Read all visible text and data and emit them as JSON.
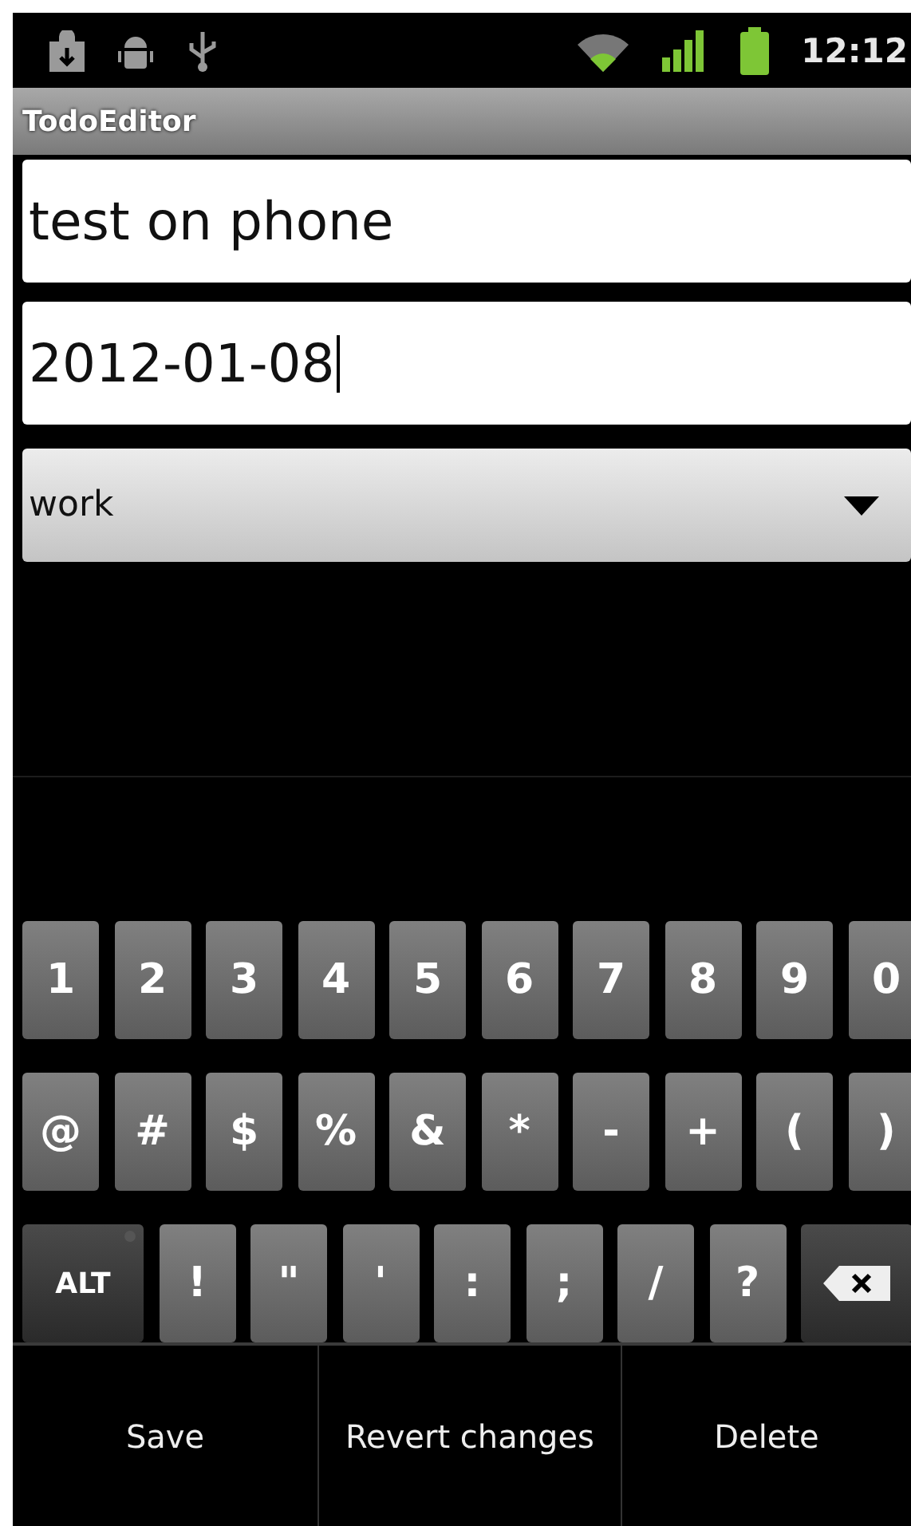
{
  "status_bar": {
    "time": "12:12"
  },
  "title_bar": {
    "title": "TodoEditor"
  },
  "fields": [
    {
      "value": "test on phone",
      "focused": false
    },
    {
      "value": "2012-01-08",
      "focused": true
    }
  ],
  "spinner": {
    "value": "work"
  },
  "keyboard": {
    "rows": [
      [
        {
          "label": "1",
          "kind": "char"
        },
        {
          "label": "2",
          "kind": "char"
        },
        {
          "label": "3",
          "kind": "char"
        },
        {
          "label": "4",
          "kind": "char"
        },
        {
          "label": "5",
          "kind": "char"
        },
        {
          "label": "6",
          "kind": "char"
        },
        {
          "label": "7",
          "kind": "char"
        },
        {
          "label": "8",
          "kind": "char"
        },
        {
          "label": "9",
          "kind": "char"
        },
        {
          "label": "0",
          "kind": "char"
        }
      ],
      [
        {
          "label": "@",
          "kind": "char"
        },
        {
          "label": "#",
          "kind": "char"
        },
        {
          "label": "$",
          "kind": "char"
        },
        {
          "label": "%",
          "kind": "char"
        },
        {
          "label": "&",
          "kind": "char"
        },
        {
          "label": "*",
          "kind": "char"
        },
        {
          "label": "-",
          "kind": "char"
        },
        {
          "label": "+",
          "kind": "char"
        },
        {
          "label": "(",
          "kind": "char"
        },
        {
          "label": ")",
          "kind": "char"
        }
      ],
      [
        {
          "label": "ALT",
          "kind": "alt"
        },
        {
          "label": "!",
          "kind": "char"
        },
        {
          "label": "\"",
          "kind": "char"
        },
        {
          "label": "'",
          "kind": "char"
        },
        {
          "label": ":",
          "kind": "char"
        },
        {
          "label": ";",
          "kind": "char"
        },
        {
          "label": "/",
          "kind": "char"
        },
        {
          "label": "?",
          "kind": "char"
        },
        {
          "kind": "backspace"
        }
      ]
    ]
  },
  "menu": [
    "Save",
    "Revert changes",
    "Delete"
  ]
}
